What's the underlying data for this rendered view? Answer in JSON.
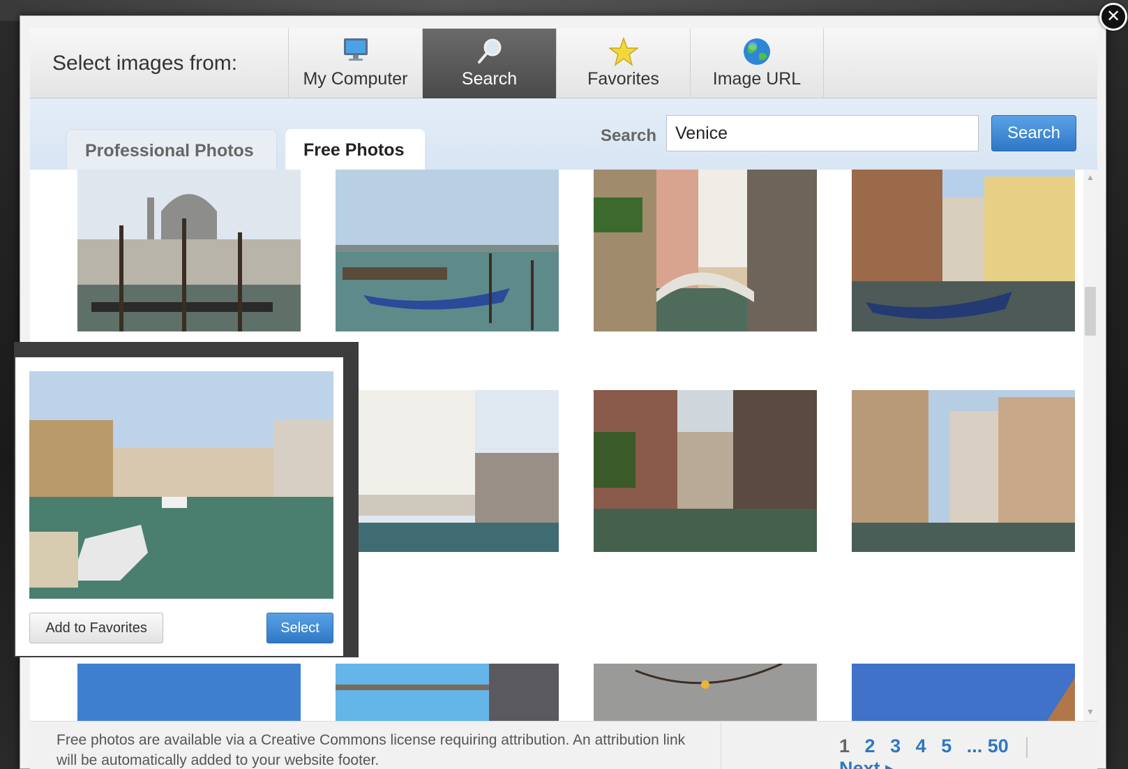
{
  "dialog": {
    "close_label": "✕"
  },
  "source_bar": {
    "label": "Select images from:",
    "tabs": [
      {
        "label": "My Computer",
        "icon": "monitor-icon"
      },
      {
        "label": "Search",
        "icon": "magnifier-icon",
        "active": true
      },
      {
        "label": "Favorites",
        "icon": "star-icon"
      },
      {
        "label": "Image URL",
        "icon": "globe-icon"
      }
    ]
  },
  "photo_tabs": [
    {
      "label": "Professional Photos"
    },
    {
      "label": "Free Photos",
      "active": true
    }
  ],
  "search": {
    "label": "Search",
    "value": "Venice",
    "button_label": "Search"
  },
  "results": {
    "thumbnails": [
      {
        "subject": "Basilica with gondolas"
      },
      {
        "subject": "Gondolas on lagoon"
      },
      {
        "subject": "Canal with bridge"
      },
      {
        "subject": "Gondolas by buildings"
      },
      {
        "subject": "Grand Canal view"
      },
      {
        "subject": "Arcaded building on canal"
      },
      {
        "subject": "Narrow canal"
      },
      {
        "subject": "Canal with old houses"
      },
      {
        "subject": "Sky view"
      },
      {
        "subject": "Sky and rooftop"
      },
      {
        "subject": "Street lights"
      },
      {
        "subject": "Blue sky"
      }
    ]
  },
  "popup": {
    "add_favorites_label": "Add to Favorites",
    "select_label": "Select"
  },
  "footer": {
    "note": "Free photos are available via a Creative Commons license requiring attribution. An attribution link will be automatically added to your website footer.",
    "pages": [
      "1",
      "2",
      "3",
      "4",
      "5",
      "... 50"
    ],
    "current_page": "1",
    "next_label": "Next ▸"
  },
  "colors": {
    "accent": "#2f77c4",
    "active_tab": "#4a4a4a",
    "search_row_bg": "#dde8f4"
  }
}
